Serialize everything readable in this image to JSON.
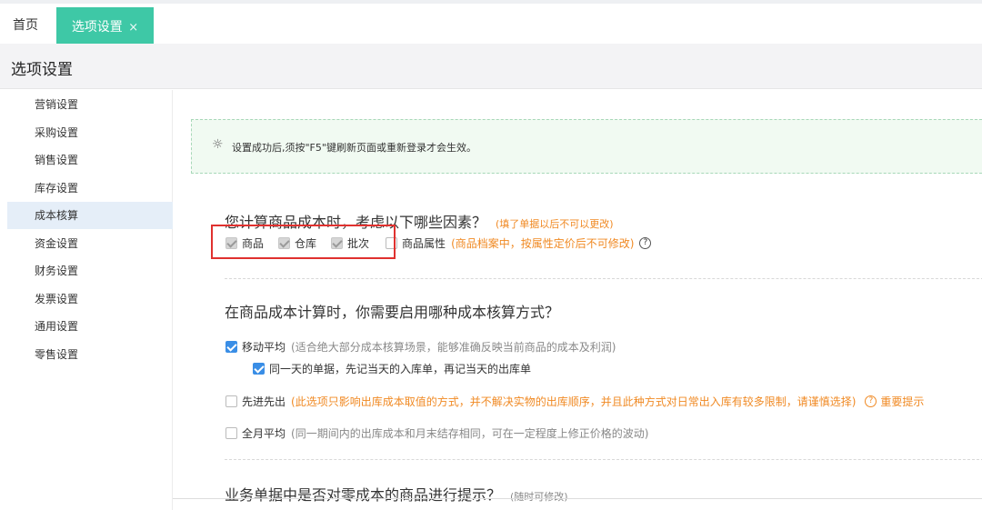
{
  "tabs": {
    "home": "首页",
    "active": "选项设置",
    "close": "×"
  },
  "page_title": "选项设置",
  "sidebar": {
    "items": [
      {
        "label": "营销设置"
      },
      {
        "label": "采购设置"
      },
      {
        "label": "销售设置"
      },
      {
        "label": "库存设置"
      },
      {
        "label": "成本核算",
        "active": true
      },
      {
        "label": "资金设置"
      },
      {
        "label": "财务设置"
      },
      {
        "label": "发票设置"
      },
      {
        "label": "通用设置"
      },
      {
        "label": "零售设置"
      }
    ]
  },
  "notice": {
    "icon": "lightbulb-icon",
    "text": "设置成功后,须按\"F5\"键刷新页面或重新登录才会生效。"
  },
  "section1": {
    "title": "您计算商品成本时，考虑以下哪些因素？",
    "note": "(填了单据以后不可以更改)",
    "options": [
      {
        "label": "商品",
        "checked": true,
        "disabled": true
      },
      {
        "label": "仓库",
        "checked": true,
        "disabled": true
      },
      {
        "label": "批次",
        "checked": true,
        "disabled": true
      },
      {
        "label": "商品属性",
        "checked": false
      }
    ],
    "attr_note": "(商品档案中，按属性定价后不可修改)",
    "help": "?"
  },
  "section2": {
    "title": "在商品成本计算时，你需要启用哪种成本核算方式？",
    "moving_avg": {
      "label": "移动平均",
      "desc": "(适合绝大部分成本核算场景，能够准确反映当前商品的成本及利润)",
      "checked": true
    },
    "same_day": {
      "label": "同一天的单据，先记当天的入库单，再记当天的出库单",
      "checked": true
    },
    "fifo": {
      "label": "先进先出",
      "desc": "(此选项只影响出库成本取值的方式，并不解决实物的出库顺序，并且此种方式对日常出入库有较多限制，请谨慎选择)",
      "tip": "重要提示",
      "checked": false
    },
    "monthly_avg": {
      "label": "全月平均",
      "desc": "(同一期间内的出库成本和月末结存相同，可在一定程度上修正价格的波动)",
      "checked": false
    }
  },
  "section3": {
    "title": "业务单据中是否对零成本的商品进行提示？",
    "note": "(随时可修改)"
  },
  "colors": {
    "accent": "#3ec8a6",
    "orange": "#f08a24",
    "checkbox_blue": "#3a8ee6",
    "highlight_red": "#e0312f"
  }
}
